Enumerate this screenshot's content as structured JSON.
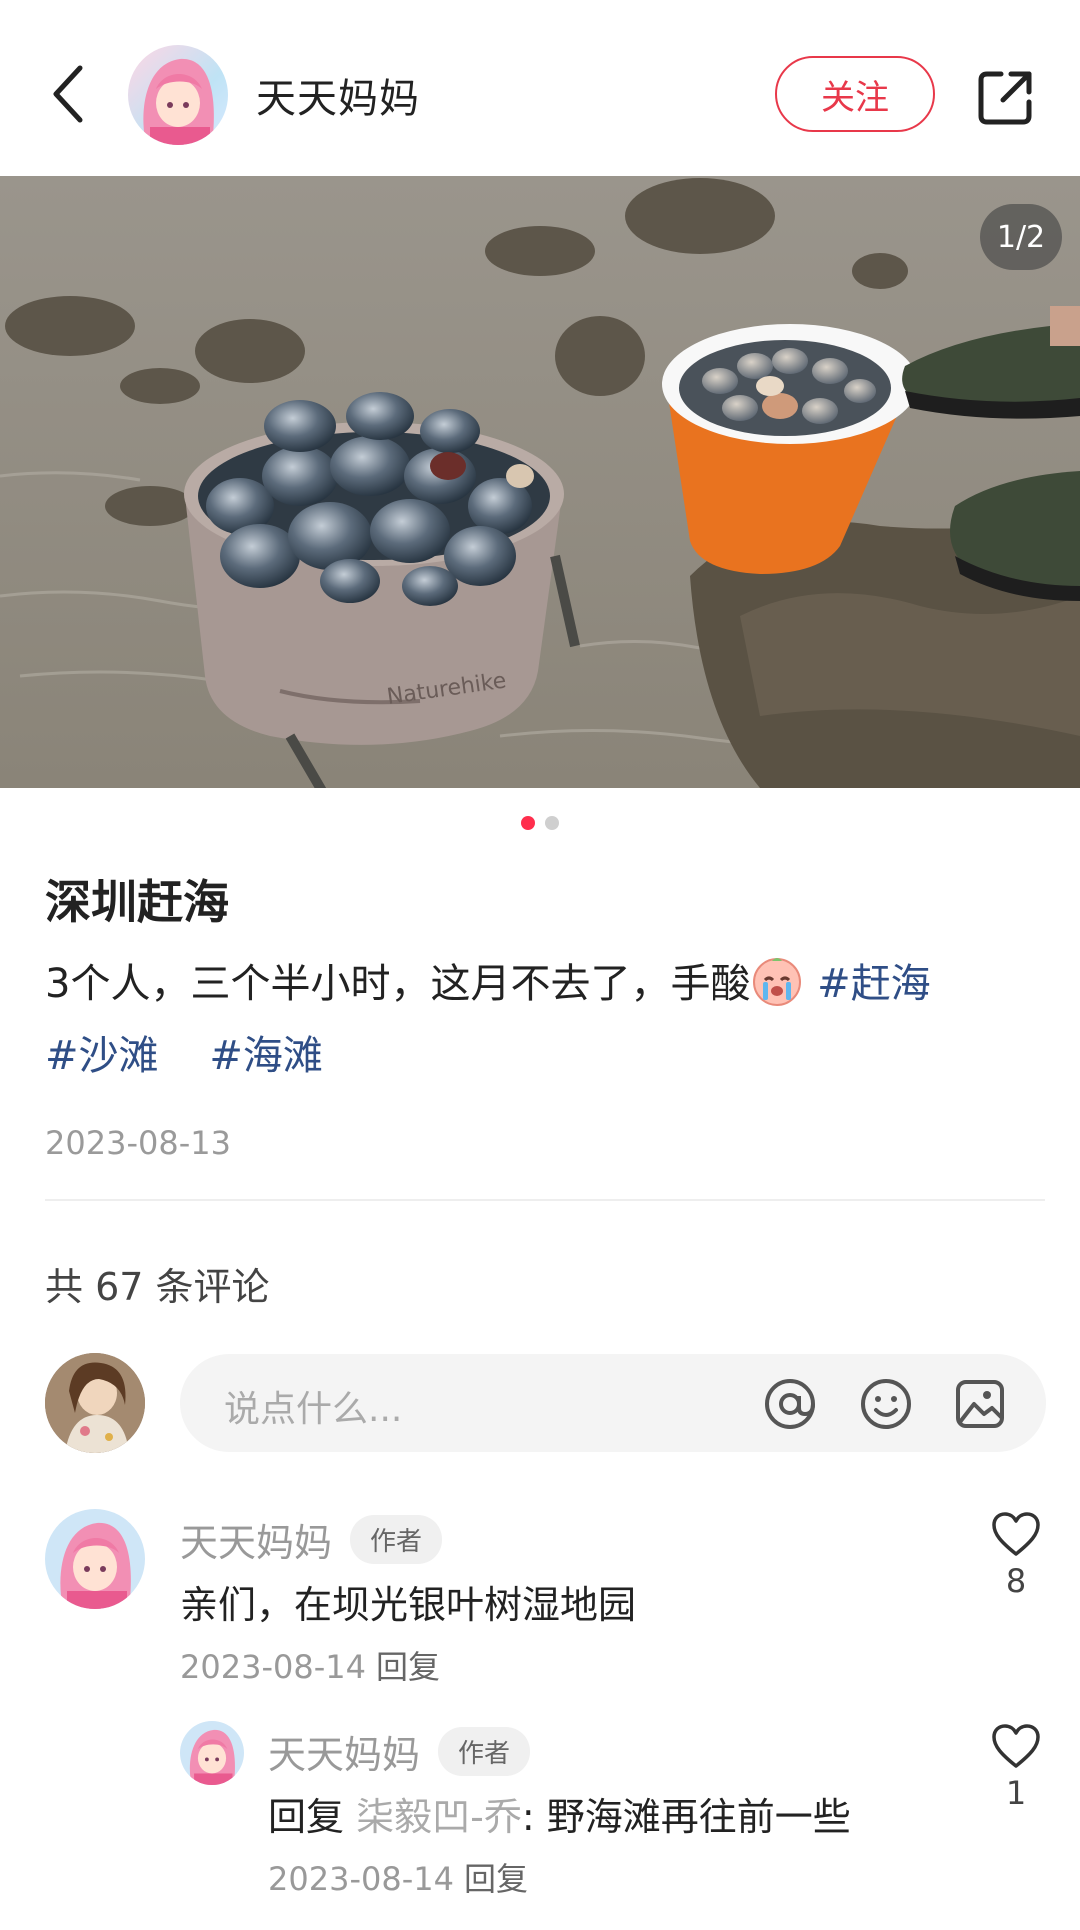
{
  "header": {
    "author_name": "天天妈妈",
    "follow_label": "关注"
  },
  "photo": {
    "page_indicator": "1/2",
    "total_images": 2,
    "current_index": 1
  },
  "post": {
    "title": "深圳赶海",
    "body_text": "3个人，三个半小时，这月不去了，手酸",
    "hashtags": [
      "#赶海",
      "#沙滩",
      "#海滩"
    ],
    "date": "2023-08-13"
  },
  "comments_section": {
    "count_label": "共 67 条评论",
    "input_placeholder": "说点什么..."
  },
  "comments": [
    {
      "name": "天天妈妈",
      "badge": "作者",
      "text": "亲们，在坝光银叶树湿地园",
      "date": "2023-08-14",
      "reply_label": "回复",
      "likes": "8"
    }
  ],
  "replies": [
    {
      "name": "天天妈妈",
      "badge": "作者",
      "reply_prefix": "回复",
      "reply_to": "柒毅凹-乔",
      "text": ": 野海滩再往前一些",
      "date": "2023-08-14",
      "reply_label": "回复",
      "likes": "1"
    }
  ],
  "colors": {
    "accent": "#e8384a",
    "hashtag": "#2f4e86",
    "dot_active": "#ff2e4d"
  },
  "icons": [
    "back-icon",
    "share-icon",
    "at-icon",
    "emoji-icon",
    "image-icon",
    "heart-icon"
  ]
}
